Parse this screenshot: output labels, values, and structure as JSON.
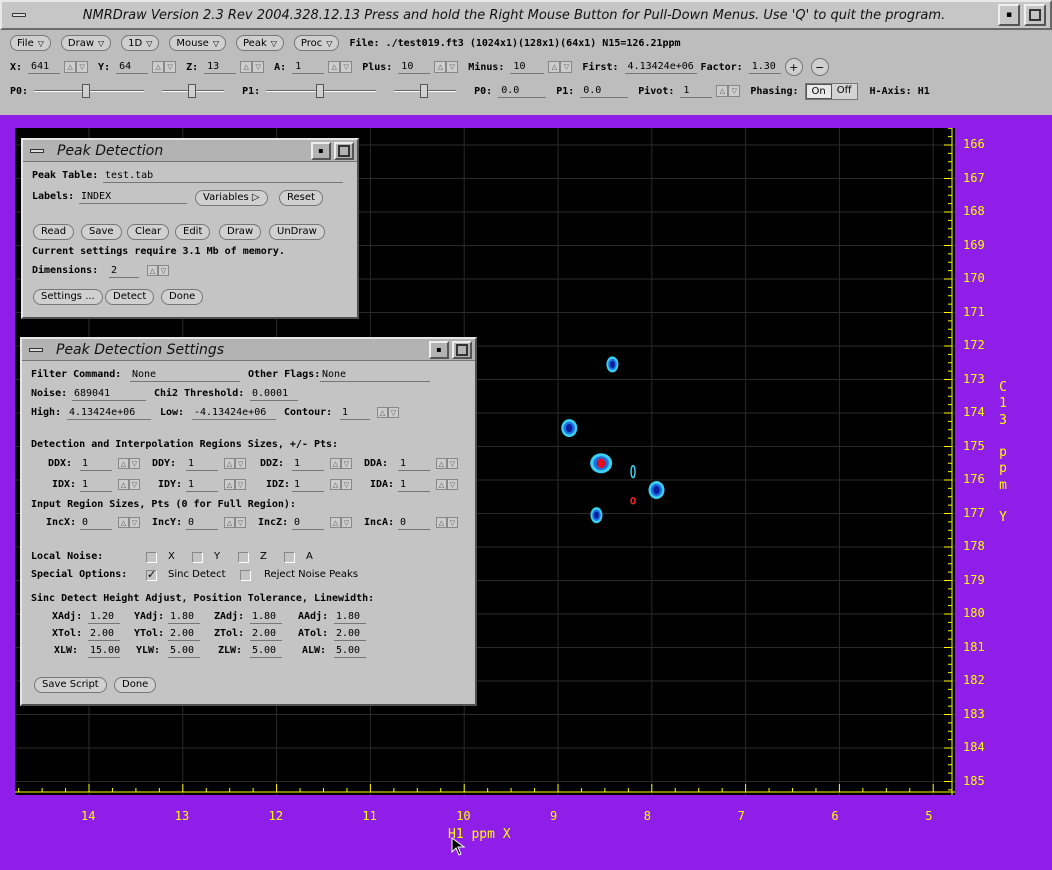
{
  "titlebar": {
    "title": "NMRDraw Version 2.3 Rev 2004.328.12.13   Press and hold the Right Mouse Button for Pull-Down Menus.   Use 'Q' to quit the program."
  },
  "menus": [
    "File",
    "Draw",
    "1D",
    "Mouse",
    "Peak",
    "Proc"
  ],
  "file_info": "File: ./test019.ft3 (1024x1)(128x1)(64x1) N15=126.21ppm",
  "row2": {
    "x_label": "X:",
    "x_val": "641",
    "y_label": "Y:",
    "y_val": "64",
    "z_label": "Z:",
    "z_val": "13",
    "a_label": "A:",
    "a_val": "1",
    "plus_label": "Plus:",
    "plus_val": "10",
    "minus_label": "Minus:",
    "minus_val": "10",
    "first_label": "First:",
    "first_val": "4.13424e+06",
    "factor_label": "Factor:",
    "factor_val": "1.30"
  },
  "row3": {
    "p0_label": "P0:",
    "p1_label": "P1:",
    "p0b_label": "P0:",
    "p0b_val": "0.0",
    "p1b_label": "P1:",
    "p1b_val": "0.0",
    "pivot_label": "Pivot:",
    "pivot_val": "1",
    "phasing_label": "Phasing:",
    "on": "On",
    "off": "Off",
    "haxis": "H-Axis: H1"
  },
  "plot": {
    "y_ticks": [
      "166",
      "167",
      "168",
      "169",
      "170",
      "171",
      "172",
      "173",
      "174",
      "175",
      "176",
      "177",
      "178",
      "179",
      "180",
      "181",
      "182",
      "183",
      "184",
      "185"
    ],
    "x_ticks": [
      "14",
      "13",
      "12",
      "11",
      "10",
      "9",
      "8",
      "7",
      "6",
      "5"
    ],
    "y_axis_chars": [
      "C",
      "1",
      "3",
      "",
      "p",
      "p",
      "m",
      "",
      "Y"
    ],
    "x_axis_label": "H1 ppm X",
    "colors": {
      "background": "#000000",
      "axis": "#ffff00",
      "grid": "#2b2b2b",
      "peak_dark": "#0a1ea0",
      "peak_mid": "#1f6fe0",
      "peak_light": "#3ad0f0",
      "peak_neg": "#ff2020"
    }
  },
  "peak_detection": {
    "title": "Peak Detection",
    "peak_table_label": "Peak Table:",
    "peak_table_val": "test.tab",
    "labels_label": "Labels:",
    "labels_val": "INDEX",
    "variables": "Variables",
    "reset": "Reset",
    "buttons": [
      "Read",
      "Save",
      "Clear",
      "Edit",
      "Draw",
      "UnDraw"
    ],
    "memory_msg": "Current settings require 3.1 Mb of memory.",
    "dimensions_label": "Dimensions:",
    "dimensions_val": "2",
    "settings": "Settings ...",
    "detect": "Detect",
    "done": "Done"
  },
  "settings": {
    "title": "Peak Detection Settings",
    "filter_label": "Filter Command:",
    "filter_val": "None",
    "other_label": "Other Flags:",
    "other_val": "None",
    "noise_label": "Noise:",
    "noise_val": "689041",
    "chi2_label": "Chi2 Threshold:",
    "chi2_val": "0.0001",
    "high_label": "High:",
    "high_val": "4.13424e+06",
    "low_label": "Low:",
    "low_val": "-4.13424e+06",
    "contour_label": "Contour:",
    "contour_val": "1",
    "detect_header": "Detection and Interpolation Regions Sizes, +/- Pts:",
    "ddx": "DDX:",
    "ddy": "DDY:",
    "ddz": "DDZ:",
    "dda": "DDA:",
    "idx": "IDX:",
    "idy": "IDY:",
    "idz": "IDZ:",
    "ida": "IDA:",
    "one": "1",
    "input_header": "Input Region Sizes, Pts (0 for Full Region):",
    "incx": "IncX:",
    "incy": "IncY:",
    "incz": "IncZ:",
    "inca": "IncA:",
    "zero": "0",
    "local_noise_label": "Local Noise:",
    "cx": "X",
    "cy": "Y",
    "cz": "Z",
    "ca": "A",
    "special_label": "Special Options:",
    "sinc_detect": "Sinc Detect",
    "reject_noise": "Reject Noise Peaks",
    "sinc_header": "Sinc Detect Height Adjust, Position Tolerance, Linewidth:",
    "xadj": "XAdj:",
    "yadj": "YAdj:",
    "zadj": "ZAdj:",
    "aadj": "AAdj:",
    "adj_val": "1.20",
    "adj_val2": "1.80",
    "xtol": "XTol:",
    "ytol": "YTol:",
    "ztol": "ZTol:",
    "atol": "ATol:",
    "tol_val": "2.00",
    "xlw": "XLW:",
    "ylw": "YLW:",
    "zlw": "ZLW:",
    "alw": "ALW:",
    "xlw_val": "15.00",
    "lw_val": "5.00",
    "save_script": "Save Script",
    "done": "Done"
  }
}
